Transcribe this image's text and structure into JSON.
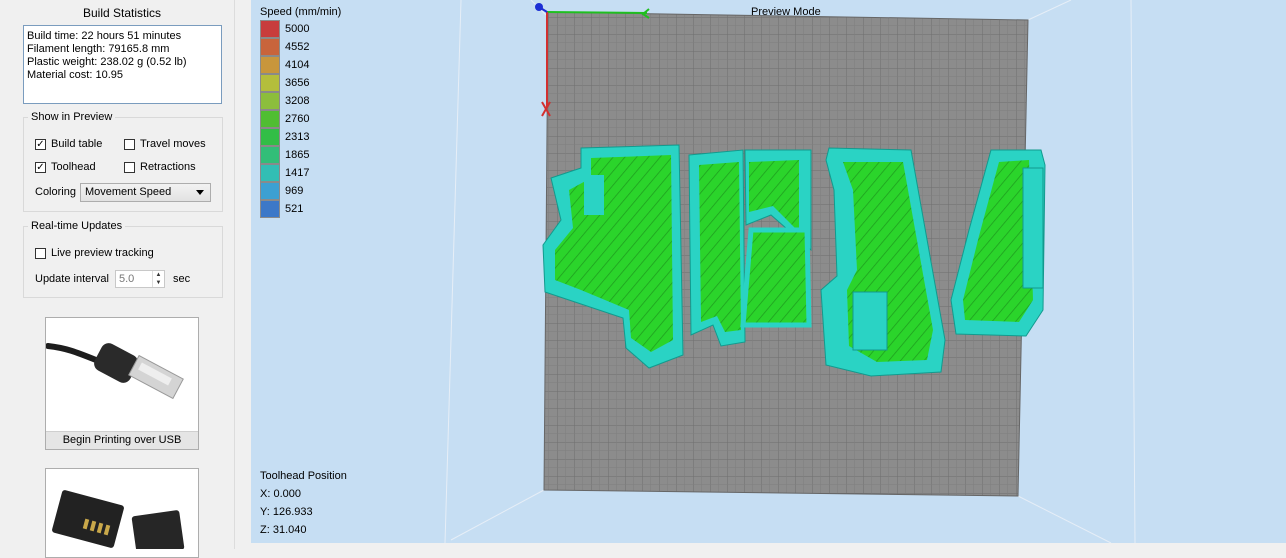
{
  "build_statistics": {
    "title": "Build Statistics",
    "lines": [
      "Build time: 22 hours 51 minutes",
      "Filament length: 79165.8 mm",
      "Plastic weight: 238.02 g (0.52 lb)",
      "Material cost: 10.95"
    ]
  },
  "show_in_preview": {
    "title": "Show in Preview",
    "build_table": {
      "label": "Build table",
      "checked": true
    },
    "travel_moves": {
      "label": "Travel moves",
      "checked": false
    },
    "toolhead": {
      "label": "Toolhead",
      "checked": true
    },
    "retractions": {
      "label": "Retractions",
      "checked": false
    },
    "coloring_label": "Coloring",
    "coloring_value": "Movement Speed"
  },
  "realtime_updates": {
    "title": "Real-time Updates",
    "live_tracking": {
      "label": "Live preview tracking",
      "checked": false
    },
    "interval_label": "Update interval",
    "interval_value": "5.0",
    "interval_unit": "sec"
  },
  "usb_button": {
    "label": "Begin Printing over USB"
  },
  "viewport": {
    "mode": "Preview Mode",
    "legend": {
      "title": "Speed (mm/min)",
      "entries": [
        {
          "value": "5000",
          "color": "#c83c3c"
        },
        {
          "value": "4552",
          "color": "#c8643c"
        },
        {
          "value": "4104",
          "color": "#c8963c"
        },
        {
          "value": "3656",
          "color": "#b4be3c"
        },
        {
          "value": "3208",
          "color": "#8cbe3c"
        },
        {
          "value": "2760",
          "color": "#50be32"
        },
        {
          "value": "2313",
          "color": "#32be46"
        },
        {
          "value": "1865",
          "color": "#32be78"
        },
        {
          "value": "1417",
          "color": "#32beb4"
        },
        {
          "value": "969",
          "color": "#3ca0d2"
        },
        {
          "value": "521",
          "color": "#3c78c8"
        }
      ]
    },
    "toolhead_position": {
      "title": "Toolhead Position",
      "x": "X: 0.000",
      "y": "Y: 126.933",
      "z": "Z: 31.040"
    }
  },
  "colors": {
    "viewport_bg": "#c6def3",
    "bed": "#8c8c8c",
    "infill": "#2bd42b",
    "perimeter": "#2ad3c4"
  }
}
